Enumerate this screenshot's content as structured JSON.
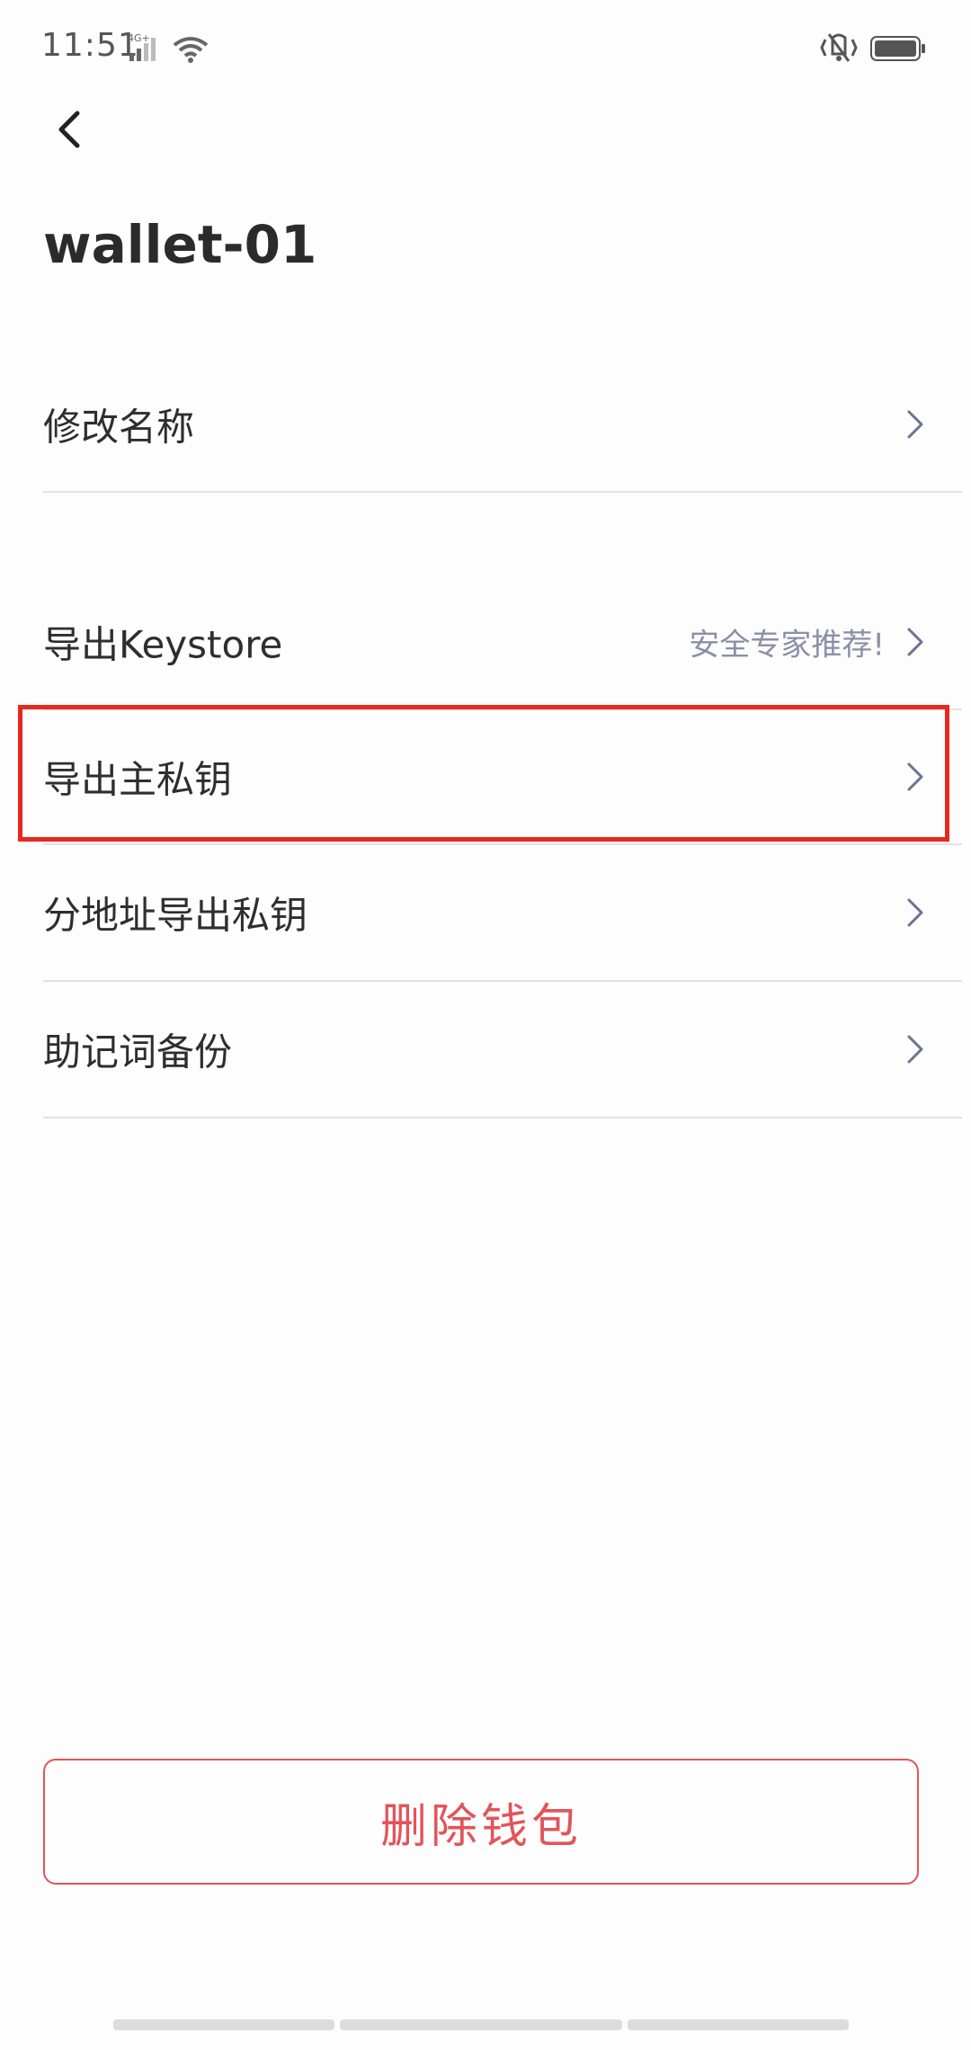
{
  "status_bar": {
    "time": "11:51",
    "network": "4G+",
    "icons": [
      "signal-icon",
      "wifi-icon",
      "vibrate-icon",
      "battery-icon"
    ]
  },
  "header": {
    "back_icon": "chevron-left-icon",
    "title": "wallet-01"
  },
  "menu": {
    "items": [
      {
        "label": "修改名称",
        "hint": ""
      },
      {
        "label": "导出Keystore",
        "hint": "安全专家推荐!"
      },
      {
        "label": "导出主私钥",
        "hint": ""
      },
      {
        "label": "分地址导出私钥",
        "hint": ""
      },
      {
        "label": "助记词备份",
        "hint": ""
      }
    ]
  },
  "actions": {
    "delete_label": "删除钱包"
  },
  "colors": {
    "highlight": "#e8281e",
    "danger": "#e2545a",
    "hint": "#8a8fa8"
  }
}
